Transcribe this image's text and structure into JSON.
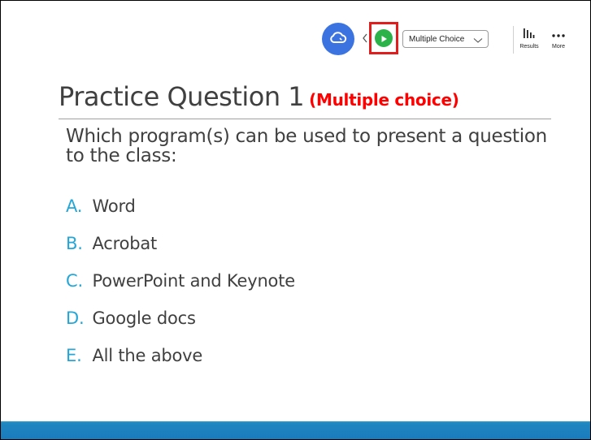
{
  "toolbar": {
    "question_type": "Multiple Choice",
    "results_label": "Results",
    "more_label": "More"
  },
  "slide": {
    "title": "Practice Question 1",
    "title_note": "(Multiple choice)",
    "question": "Which program(s) can be used to present a question to the class:",
    "options": [
      {
        "letter": "A.",
        "text": "Word"
      },
      {
        "letter": "B.",
        "text": "Acrobat"
      },
      {
        "letter": "C.",
        "text": "PowerPoint and Keynote"
      },
      {
        "letter": "D.",
        "text": "Google docs"
      },
      {
        "letter": "E.",
        "text": "All the above"
      }
    ]
  },
  "colors": {
    "cloud_button": "#3b73e0",
    "play_button": "#2bb34a",
    "highlight_box": "#e01e1e",
    "option_letter": "#25a6d6",
    "title_note": "#ff0000",
    "bottom_bar": "#1a7bbd"
  }
}
